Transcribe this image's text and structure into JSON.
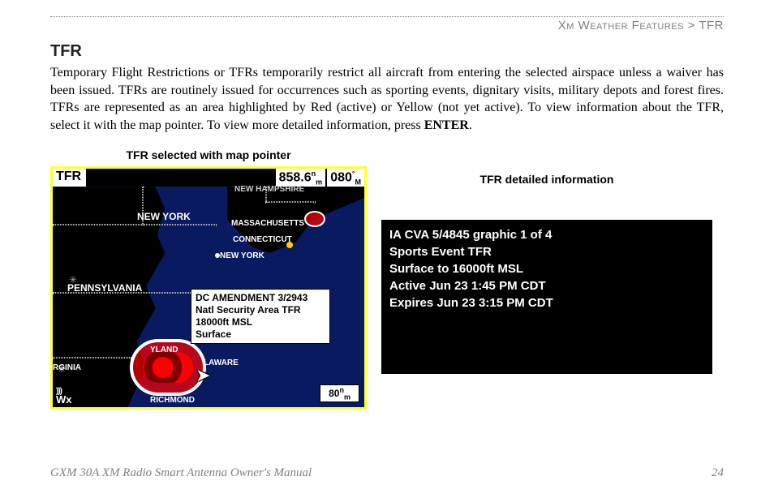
{
  "breadcrumb": {
    "section": "Xm Weather Features",
    "separator": ">",
    "page": "TFR"
  },
  "heading": "TFR",
  "paragraph_parts": {
    "before_enter": "Temporary Flight Restrictions or TFRs temporarily restrict all aircraft from entering the selected airspace unless a waiver has been issued. TFRs are routinely issued for occurrences such as sporting events, dignitary visits, military depots and forest fires. TFRs are represented as an area highlighted by Red (active) or Yellow (not yet active). To view information about the TFR, select it with the map pointer. To view more detailed information, press ",
    "enter": "ENTER",
    "after_enter": "."
  },
  "figure1": {
    "caption": "TFR selected with map pointer",
    "header_mode": "TFR",
    "header_dist": "858.6",
    "header_dist_unit_top": "n",
    "header_dist_unit_bot": "m",
    "header_brg": "080",
    "header_brg_unit_top": "°",
    "header_brg_unit_bot": "M",
    "labels": {
      "newyork_state": "NEW YORK",
      "massachusetts": "MASSACHUSETTS",
      "connecticut": "CONNECTICUT",
      "newyork_city": "NEW YORK",
      "pennsylvania": "PENNSYLVANIA",
      "rginia": "RGINIA",
      "laware": "LAWARE",
      "yland": "YLAND",
      "richmond": "RICHMOND",
      "newhampshire_partial": "NEW HAMPSHIRE"
    },
    "popup": {
      "line1": "DC AMENDMENT 3/2943",
      "line2": "Natl Security Area TFR",
      "line3": "18000ft MSL",
      "line4": "Surface"
    },
    "scale_value": "80",
    "scale_unit_top": "n",
    "scale_unit_bot": "m",
    "wx_label": "Wx"
  },
  "figure2": {
    "caption": "TFR detailed information",
    "lines": [
      "IA CVA 5/4845 graphic 1 of 4",
      "Sports Event TFR",
      "Surface to 16000ft MSL",
      "Active Jun 23 1:45 PM CDT",
      "Expires Jun 23 3:15 PM CDT"
    ]
  },
  "footer": {
    "manual": "GXM 30A XM Radio Smart Antenna Owner's Manual",
    "page": "24"
  }
}
